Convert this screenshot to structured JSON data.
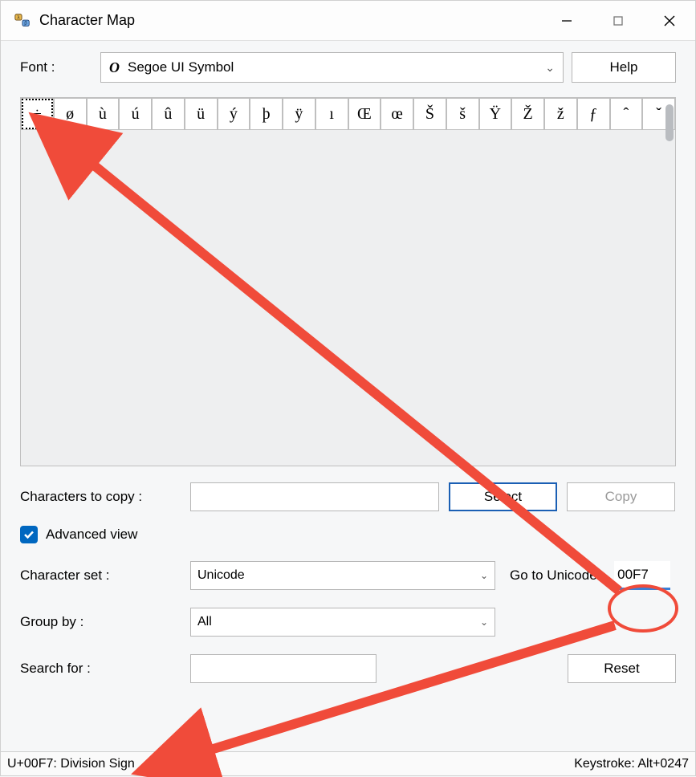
{
  "window": {
    "title": "Character Map"
  },
  "font": {
    "label": "Font :",
    "selected": "Segoe UI Symbol",
    "help_label": "Help"
  },
  "grid": {
    "chars": [
      "÷",
      "ø",
      "ù",
      "ú",
      "û",
      "ü",
      "ý",
      "þ",
      "ÿ",
      "ı",
      "Œ",
      "œ",
      "Š",
      "š",
      "Ÿ",
      "Ž",
      "ž",
      "ƒ",
      "ˆ",
      "ˇ"
    ],
    "selected_index": 0
  },
  "copy_section": {
    "label": "Characters to copy :",
    "value": "",
    "select_label": "Select",
    "copy_label": "Copy"
  },
  "advanced": {
    "checked": true,
    "label": "Advanced view"
  },
  "charset": {
    "label": "Character set :",
    "value": "Unicode",
    "goto_label": "Go to Unicode :",
    "goto_value": "00F7"
  },
  "groupby": {
    "label": "Group by :",
    "value": "All"
  },
  "search": {
    "label": "Search for :",
    "value": "",
    "reset_label": "Reset"
  },
  "status": {
    "left": "U+00F7: Division Sign",
    "right": "Keystroke: Alt+0247"
  },
  "annotation": {
    "circle_target": "goto-unicode-input",
    "arrow1_from": "goto-unicode-input",
    "arrow1_to": "char-cell-0",
    "arrow2_from": "goto-unicode-input",
    "arrow2_to": "statusbar-left",
    "color": "#f04b3a"
  }
}
